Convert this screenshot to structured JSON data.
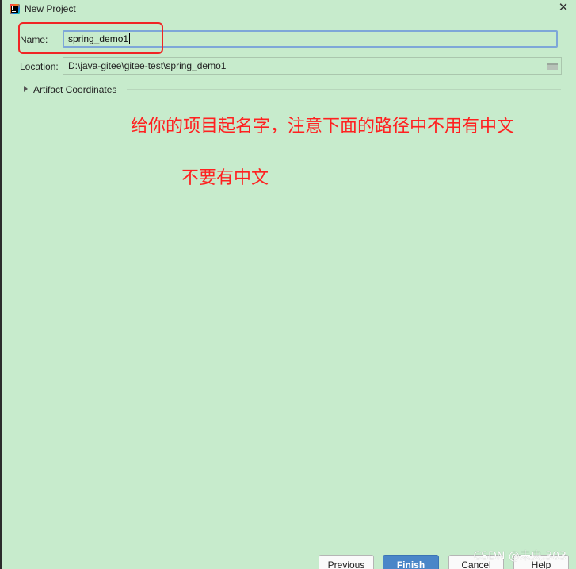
{
  "window": {
    "title": "New Project",
    "close_glyph": "✕",
    "app_icon": "intellij-idea-icon"
  },
  "form": {
    "name_label": "Name:",
    "name_value": "spring_demo1",
    "location_label": "Location:",
    "location_value": "D:\\java-gitee\\gitee-test\\spring_demo1",
    "folder_icon": "folder-icon",
    "artifact_label": "Artifact Coordinates"
  },
  "annotations": {
    "note_1": "给你的项目起名字，注意下面的路径中不用有中文",
    "note_2": "不要有中文",
    "color": "#ff2020"
  },
  "buttons": {
    "previous": "Previous",
    "finish": "Finish",
    "cancel": "Cancel",
    "help": "Help"
  },
  "watermark": "CSDN @未央.303",
  "colors": {
    "background": "#c7ebcc",
    "accent": "#4a86c8",
    "focus_border": "#7ea7d8"
  }
}
